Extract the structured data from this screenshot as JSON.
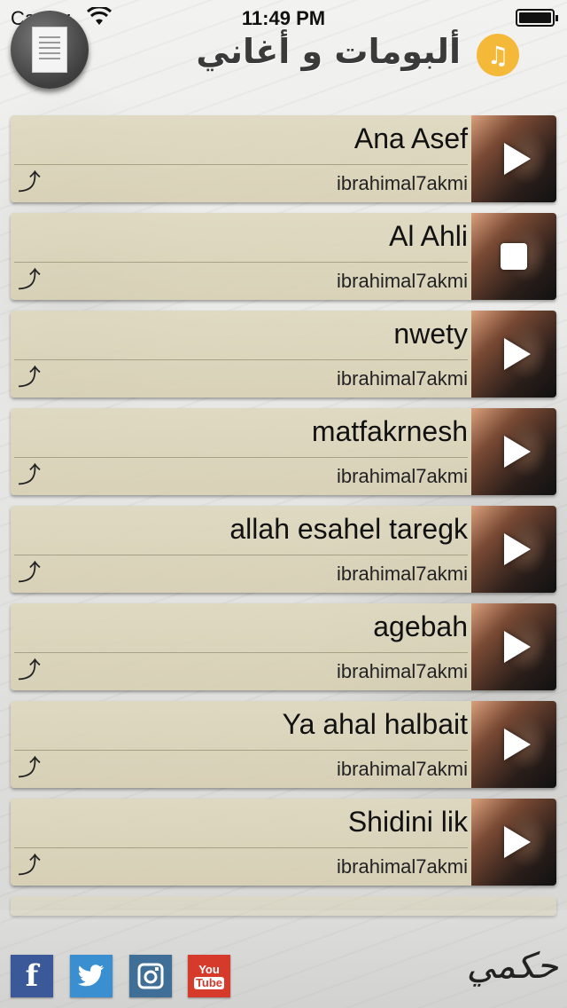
{
  "status_bar": {
    "carrier": "Carrier",
    "time": "11:49 PM"
  },
  "header": {
    "title": "ألبومات و أغاني"
  },
  "icons": {
    "wifi": "wifi-icon",
    "battery": "battery-icon",
    "document": "document-icon",
    "music": "music-note-icon",
    "share": "share-icon",
    "play": "play-icon",
    "stop": "stop-icon"
  },
  "songs": [
    {
      "title": "Ana Asef",
      "artist": "ibrahimal7akmi",
      "state": "play"
    },
    {
      "title": "Al Ahli",
      "artist": "ibrahimal7akmi",
      "state": "stop"
    },
    {
      "title": "nwety",
      "artist": "ibrahimal7akmi",
      "state": "play"
    },
    {
      "title": "matfakrnesh",
      "artist": "ibrahimal7akmi",
      "state": "play"
    },
    {
      "title": "allah esahel taregk",
      "artist": "ibrahimal7akmi",
      "state": "play"
    },
    {
      "title": "agebah",
      "artist": "ibrahimal7akmi",
      "state": "play"
    },
    {
      "title": "Ya ahal halbait",
      "artist": "ibrahimal7akmi",
      "state": "play"
    },
    {
      "title": "Shidini lik",
      "artist": "ibrahimal7akmi",
      "state": "play"
    }
  ],
  "social": {
    "facebook": "f",
    "twitter": "t",
    "instagram": "◘",
    "youtube_top": "You",
    "youtube_bottom": "Tube"
  },
  "footer": {
    "signature": "حكمي"
  },
  "colors": {
    "accent": "#f5b93a",
    "row_bg": "#dcd6bc",
    "facebook": "#3b5998",
    "twitter": "#3a8fd0",
    "instagram": "#3f6f96",
    "youtube": "#d63a2a"
  }
}
